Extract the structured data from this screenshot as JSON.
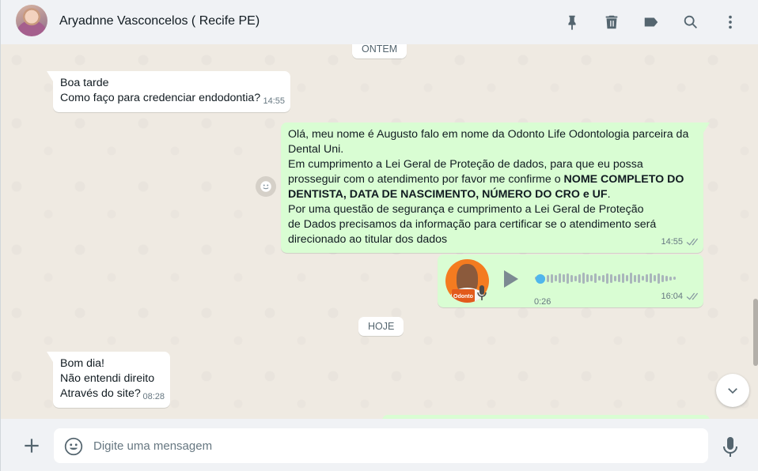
{
  "header": {
    "contact_name": "Aryadnne Vasconcelos ( Recife PE)",
    "icons": [
      "pin-icon",
      "trash-icon",
      "label-icon",
      "search-icon",
      "menu-icon"
    ]
  },
  "chat": {
    "date_yesterday": "ONTEM",
    "date_today": "HOJE",
    "msg1": {
      "lines": [
        "Boa tarde",
        "Como faço para credenciar endodontia?"
      ],
      "time": "14:55"
    },
    "msg2": {
      "p1": "Olá, meu nome é Augusto  falo em nome da Odonto Life Odontologia parceira da Dental Uni.",
      "p2_plain": "Em cumprimento a Lei Geral de Proteção de dados, para que eu possa prosseguir com o atendimento por favor me confirme o ",
      "p2_bold": "NOME COMPLETO DO DENTISTA, DATA DE NASCIMENTO, NÚMERO DO CRO e UF",
      "p2_end": ".",
      "p3": "Por uma questão de segurança e cumprimento a Lei Geral de Proteção de Dados precisamos da informação para certificar se o atendimento será direcionado ao titular dos dados",
      "time": "14:55",
      "status": "read"
    },
    "audio": {
      "brand_text": "Odonto",
      "duration": "0:26",
      "time": "16:04",
      "progress": 0
    },
    "msg3": {
      "lines": [
        "Bom dia!",
        "Não entendi direito",
        "Através do site?"
      ],
      "time": "08:28"
    }
  },
  "footer": {
    "placeholder": "Digite uma mensagem",
    "value": ""
  },
  "colors": {
    "incoming_bubble": "#ffffff",
    "outgoing_bubble": "#d9fdd3",
    "chat_background": "#efeae2",
    "panel": "#f0f2f5",
    "audio_accent": "#4fb6ec"
  }
}
